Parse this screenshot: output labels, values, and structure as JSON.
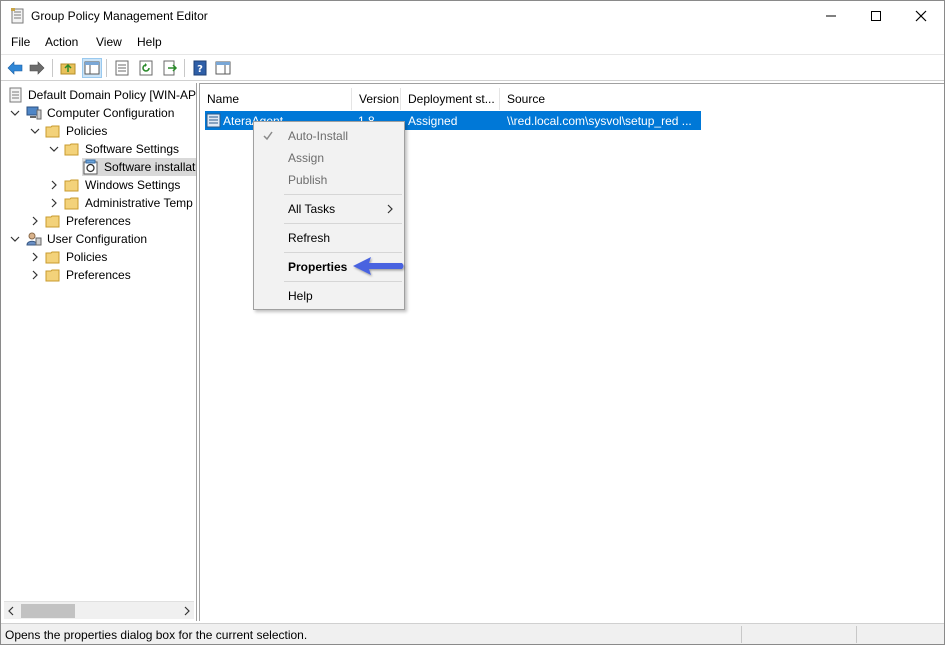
{
  "window": {
    "title": "Group Policy Management Editor"
  },
  "menu": {
    "file": "File",
    "action": "Action",
    "view": "View",
    "help": "Help"
  },
  "tree": {
    "root": "Default Domain Policy [WIN-AP",
    "computer_config": "Computer Configuration",
    "cc_policies": "Policies",
    "software_settings": "Software Settings",
    "software_installation": "Software installat",
    "windows_settings": "Windows Settings",
    "admin_templates": "Administrative Temp",
    "cc_preferences": "Preferences",
    "user_config": "User Configuration",
    "uc_policies": "Policies",
    "uc_preferences": "Preferences"
  },
  "list": {
    "columns": [
      "Name",
      "Version",
      "Deployment st...",
      "Source"
    ],
    "rows": [
      {
        "name": "AteraAgent",
        "version": "1.8",
        "deployment": "Assigned",
        "source": "\\\\red.local.com\\sysvol\\setup_red ..."
      }
    ]
  },
  "context_menu": {
    "items": [
      {
        "label": "Auto-Install",
        "enabled": false,
        "checked": true
      },
      {
        "label": "Assign",
        "enabled": false
      },
      {
        "label": "Publish",
        "enabled": false
      },
      {
        "label": "All Tasks",
        "enabled": true,
        "submenu": true
      },
      {
        "label": "Refresh",
        "enabled": true
      },
      {
        "label": "Properties",
        "enabled": true,
        "bold": true
      },
      {
        "label": "Help",
        "enabled": true
      }
    ]
  },
  "status": {
    "text": "Opens the properties dialog box for the current selection."
  },
  "colors": {
    "selection": "#0078d7",
    "annotation_arrow": "#4a64e0"
  }
}
